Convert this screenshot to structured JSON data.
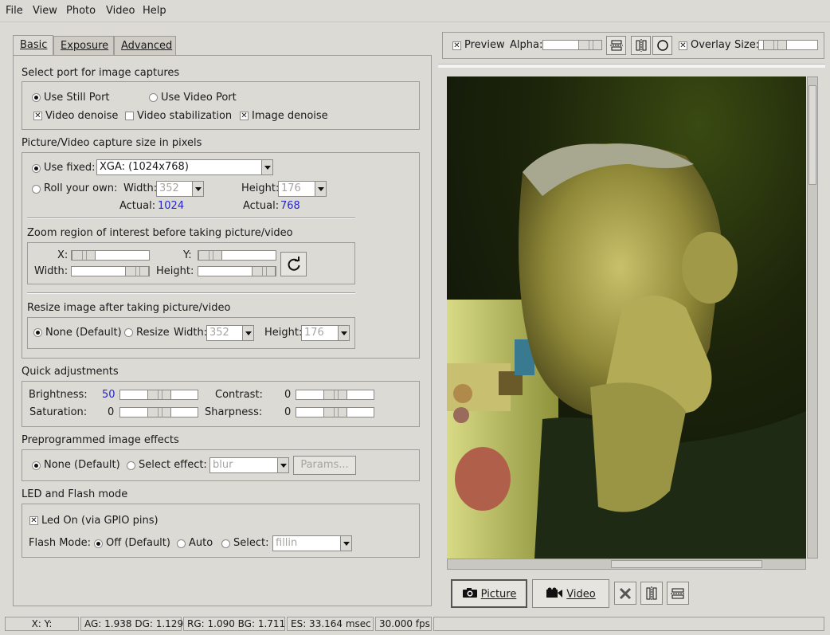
{
  "menu": [
    "File",
    "View",
    "Photo",
    "Video",
    "Help"
  ],
  "tabs": [
    "Basic",
    "Exposure",
    "Advanced"
  ],
  "port": {
    "title": "Select port for image captures",
    "still": "Use Still Port",
    "video": "Use Video Port",
    "video_denoise": "Video denoise",
    "video_stabilization": "Video stabilization",
    "image_denoise": "Image denoise"
  },
  "capture": {
    "title": "Picture/Video capture size in pixels",
    "use_fixed": "Use fixed:",
    "fixed_value": "XGA: (1024x768)",
    "roll_own": "Roll your own:",
    "width_label": "Width:",
    "width_value": "352",
    "height_label": "Height:",
    "height_value": "176",
    "actual_label": "Actual:",
    "actual_width": "1024",
    "actual_height": "768"
  },
  "zoom": {
    "title": "Zoom region of interest before taking picture/video",
    "x": "X:",
    "y": "Y:",
    "width": "Width:",
    "height": "Height:"
  },
  "resize": {
    "title": "Resize image after taking picture/video",
    "none": "None (Default)",
    "resize": "Resize",
    "width_label": "Width:",
    "width_value": "352",
    "height_label": "Height:",
    "height_value": "176"
  },
  "quick": {
    "title": "Quick adjustments",
    "brightness": "Brightness:",
    "brightness_value": "50",
    "contrast": "Contrast:",
    "contrast_value": "0",
    "saturation": "Saturation:",
    "saturation_value": "0",
    "sharpness": "Sharpness:",
    "sharpness_value": "0"
  },
  "effects": {
    "title": "Preprogrammed image effects",
    "none": "None (Default)",
    "select": "Select effect:",
    "effect_value": "blur",
    "params": "Params..."
  },
  "led": {
    "title": "LED and Flash mode",
    "led_on": "Led On (via GPIO pins)",
    "flash_mode": "Flash Mode:",
    "off": "Off (Default)",
    "auto": "Auto",
    "select": "Select:",
    "select_value": "fillin"
  },
  "preview": {
    "preview": "Preview",
    "alpha": "Alpha:",
    "overlay": "Overlay",
    "size": "Size:"
  },
  "buttons": {
    "picture": "Picture",
    "video": "Video"
  },
  "status": {
    "xy": "X:   Y:",
    "ag_dg": "AG: 1.938 DG: 1.129",
    "rg_bg": "RG: 1.090 BG: 1.711",
    "es": "ES: 33.164 msec",
    "fps": "30.000 fps"
  },
  "colors": {
    "accent_value": "#2525c8",
    "background": "#dcdad5"
  }
}
